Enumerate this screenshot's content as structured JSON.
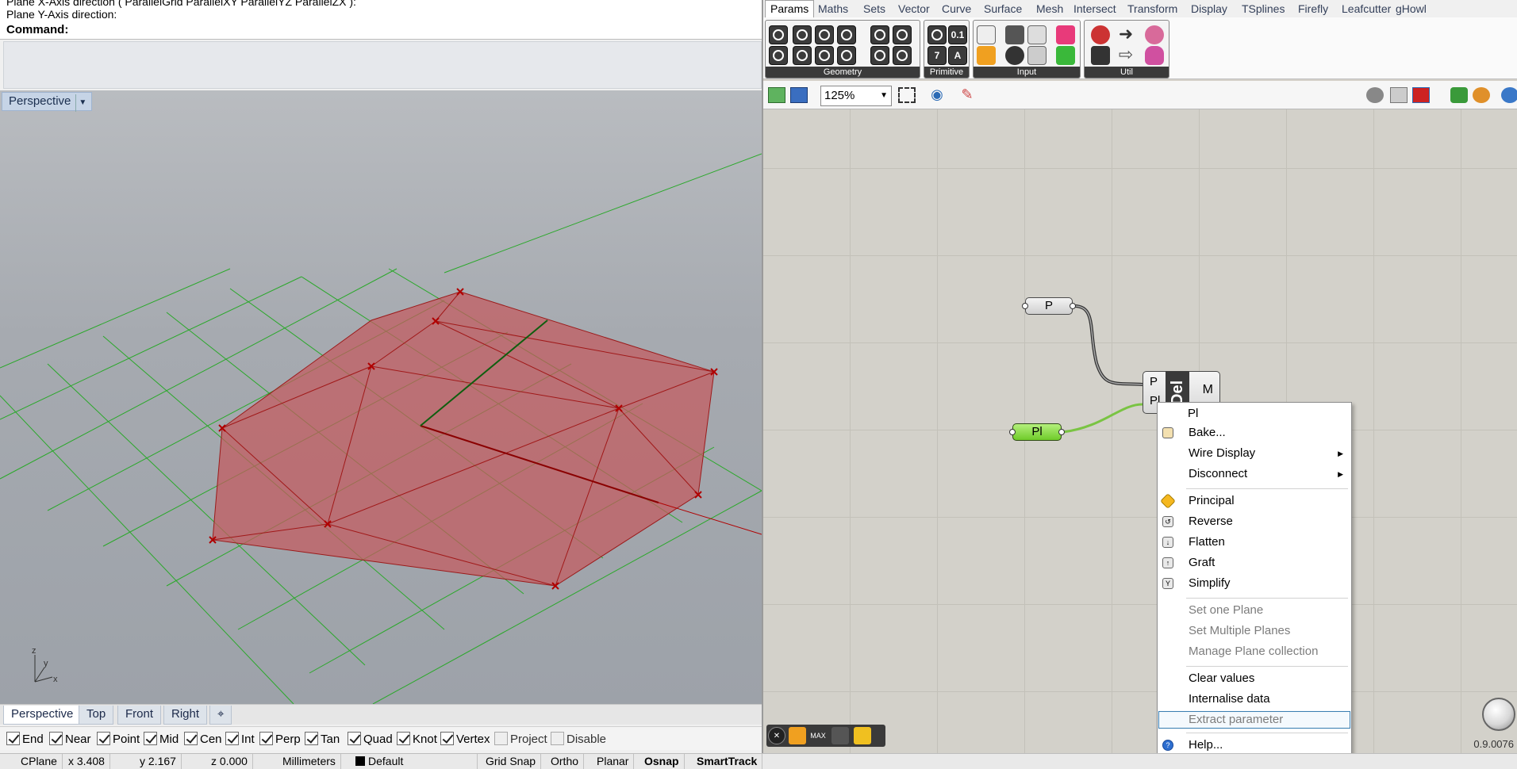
{
  "rhino": {
    "history_lines": [
      "Plane X-Axis direction ( ParallelGrid  ParallelXY  ParallelYZ  ParallelZX ):",
      "Plane Y-Axis direction:"
    ],
    "command_label": "Command:",
    "viewport_title": "Perspective",
    "axis_labels": {
      "z": "z",
      "y": "y",
      "x": "x"
    },
    "viewport_tabs": [
      "Perspective",
      "Top",
      "Front",
      "Right",
      "⌖"
    ],
    "osnaps": [
      {
        "label": "End",
        "checked": true
      },
      {
        "label": "Near",
        "checked": true
      },
      {
        "label": "Point",
        "checked": true
      },
      {
        "label": "Mid",
        "checked": true
      },
      {
        "label": "Cen",
        "checked": true
      },
      {
        "label": "Int",
        "checked": true
      },
      {
        "label": "Perp",
        "checked": true
      },
      {
        "label": "Tan",
        "checked": true
      },
      {
        "label": "Quad",
        "checked": true
      },
      {
        "label": "Knot",
        "checked": true
      },
      {
        "label": "Vertex",
        "checked": true
      },
      {
        "label": "Project",
        "checked": false
      },
      {
        "label": "Disable",
        "checked": false
      }
    ],
    "status": {
      "cplane": "CPlane",
      "x": "x 3.408",
      "y": "y 2.167",
      "z": "z 0.000",
      "units": "Millimeters",
      "layer": "Default",
      "grid_snap": "Grid Snap",
      "ortho": "Ortho",
      "planar": "Planar",
      "osnap": "Osnap",
      "smarttrack": "SmartTrack"
    },
    "colors": {
      "mesh_fill": "#c45a5e",
      "grid_green": "#2aa82a",
      "point_red": "#b00000"
    }
  },
  "gh": {
    "tabs": [
      "Params",
      "Maths",
      "Sets",
      "Vector",
      "Curve",
      "Surface",
      "Mesh",
      "Intersect",
      "Transform",
      "Display",
      "TSplines",
      "Firefly",
      "Leafcutter",
      "gHowl"
    ],
    "ribbon_panels": [
      "Geometry",
      "Primitive",
      "Input",
      "Util"
    ],
    "primitive_glyphs": [
      "0.1",
      "7",
      "A"
    ],
    "zoom": "125%",
    "nodes": {
      "p_label": "P",
      "pl_label": "Pl",
      "comp_inputs": [
        "P",
        "Pl"
      ],
      "comp_name": "Del",
      "comp_output": "M"
    },
    "footer_max": "MAX",
    "version": "0.9.0076"
  },
  "context_menu": {
    "title": "Pl",
    "groups": [
      [
        {
          "label": "Bake...",
          "icon": "bake-icon",
          "enabled": true
        },
        {
          "label": "Wire Display",
          "submenu": true,
          "enabled": true
        },
        {
          "label": "Disconnect",
          "submenu": true,
          "enabled": true
        }
      ],
      [
        {
          "label": "Principal",
          "icon": "principal-icon",
          "enabled": true
        },
        {
          "label": "Reverse",
          "icon": "reverse-icon",
          "enabled": true
        },
        {
          "label": "Flatten",
          "icon": "flatten-icon",
          "enabled": true
        },
        {
          "label": "Graft",
          "icon": "graft-icon",
          "enabled": true
        },
        {
          "label": "Simplify",
          "icon": "simplify-icon",
          "enabled": true
        }
      ],
      [
        {
          "label": "Set one Plane",
          "enabled": false
        },
        {
          "label": "Set Multiple Planes",
          "enabled": false
        },
        {
          "label": "Manage Plane collection",
          "enabled": false
        }
      ],
      [
        {
          "label": "Clear values",
          "enabled": true
        },
        {
          "label": "Internalise data",
          "enabled": true
        },
        {
          "label": "Extract parameter",
          "enabled": false,
          "highlighted": true
        }
      ],
      [
        {
          "label": "Help...",
          "icon": "help-icon",
          "enabled": true
        }
      ]
    ]
  }
}
